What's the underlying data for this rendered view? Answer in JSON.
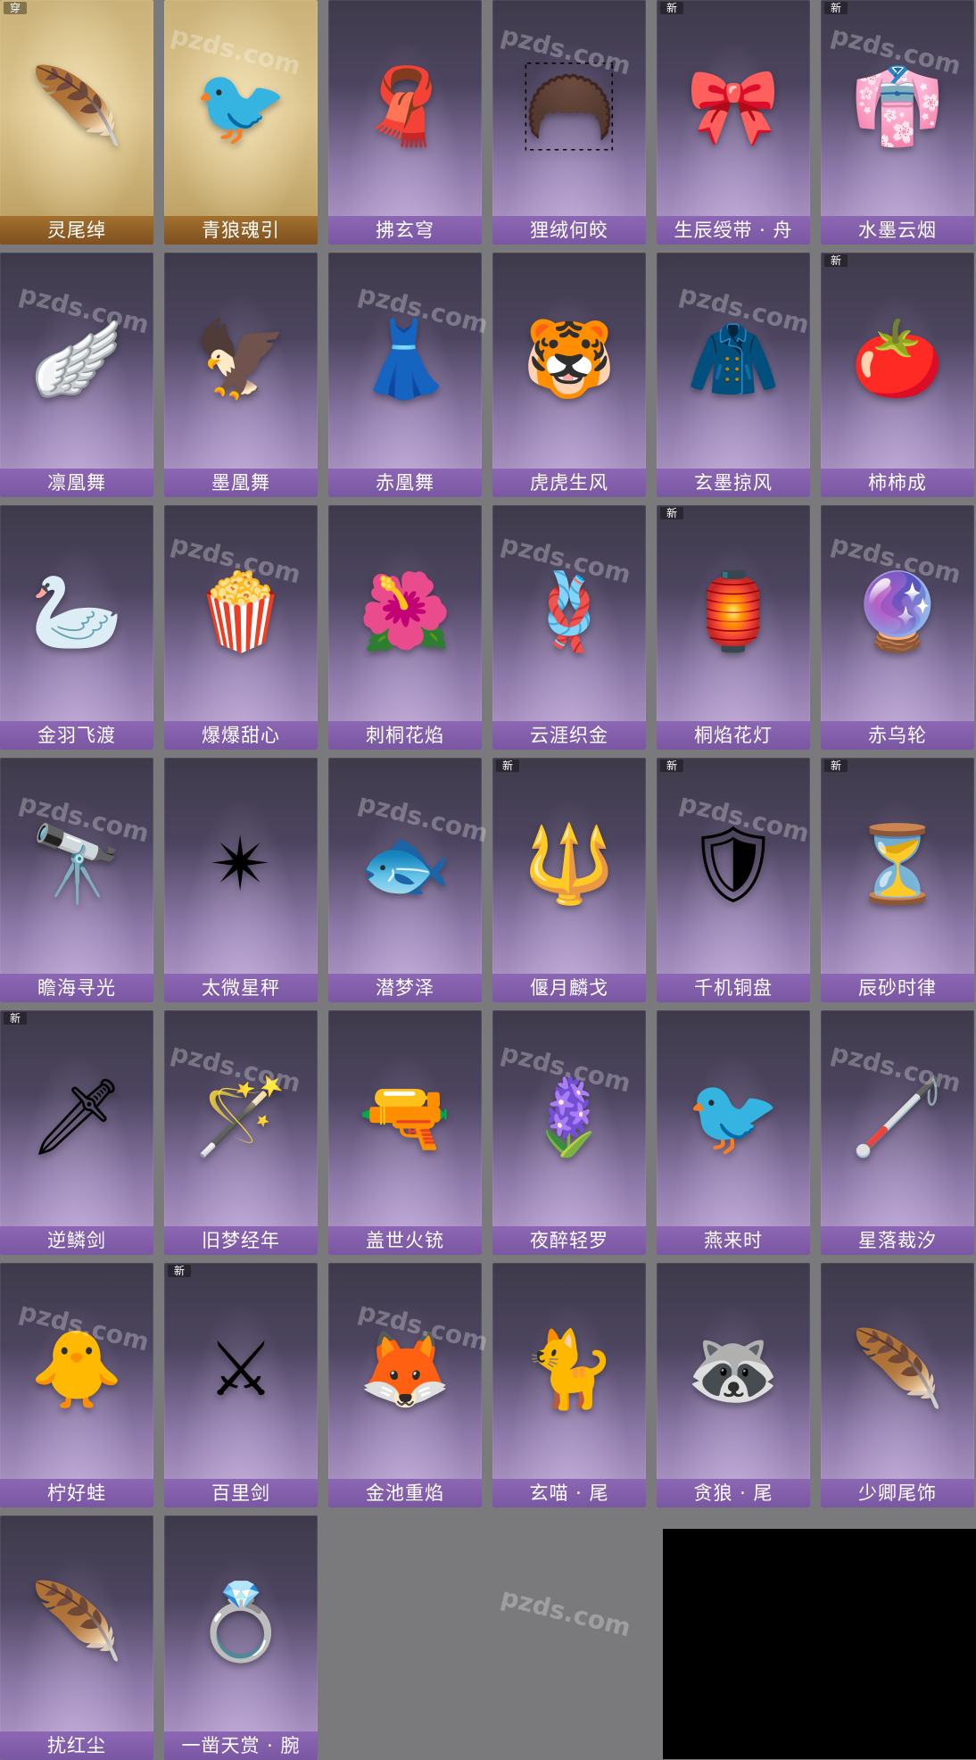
{
  "watermark": "pzds.com",
  "items": [
    {
      "label": "灵尾绰",
      "icon": "🪶",
      "badge": "穿",
      "theme": "gold"
    },
    {
      "label": "青狼魂引",
      "icon": "🐦",
      "badge": "",
      "theme": "gold"
    },
    {
      "label": "拂玄穹",
      "icon": "🧣",
      "badge": "",
      "theme": "purple"
    },
    {
      "label": "狸绒何皎",
      "icon": "🦱",
      "badge": "",
      "theme": "purple"
    },
    {
      "label": "生辰绶带 · 舟",
      "icon": "🎀",
      "badge": "新",
      "theme": "purple"
    },
    {
      "label": "水墨云烟",
      "icon": "👘",
      "badge": "新",
      "theme": "purple"
    },
    {
      "label": "凛凰舞",
      "icon": "🪽",
      "badge": "",
      "theme": "purple"
    },
    {
      "label": "墨凰舞",
      "icon": "🦅",
      "badge": "",
      "theme": "purple"
    },
    {
      "label": "赤凰舞",
      "icon": "👗",
      "badge": "",
      "theme": "purple"
    },
    {
      "label": "虎虎生风",
      "icon": "🐯",
      "badge": "",
      "theme": "purple"
    },
    {
      "label": "玄墨掠风",
      "icon": "🧥",
      "badge": "",
      "theme": "purple"
    },
    {
      "label": "柿柿成",
      "icon": "🍅",
      "badge": "新",
      "theme": "purple"
    },
    {
      "label": "金羽飞渡",
      "icon": "🦢",
      "badge": "",
      "theme": "purple"
    },
    {
      "label": "爆爆甜心",
      "icon": "🍿",
      "badge": "",
      "theme": "purple"
    },
    {
      "label": "刺桐花焰",
      "icon": "🌺",
      "badge": "",
      "theme": "purple"
    },
    {
      "label": "云涯织金",
      "icon": "🪢",
      "badge": "",
      "theme": "purple"
    },
    {
      "label": "桐焰花灯",
      "icon": "🏮",
      "badge": "新",
      "theme": "purple"
    },
    {
      "label": "赤乌轮",
      "icon": "🔮",
      "badge": "",
      "theme": "purple"
    },
    {
      "label": "瞻海寻光",
      "icon": "🔭",
      "badge": "",
      "theme": "purple"
    },
    {
      "label": "太微星秤",
      "icon": "✴",
      "badge": "",
      "theme": "purple"
    },
    {
      "label": "潜梦泽",
      "icon": "🐟",
      "badge": "",
      "theme": "purple"
    },
    {
      "label": "偃月麟戈",
      "icon": "🔱",
      "badge": "新",
      "theme": "purple"
    },
    {
      "label": "千机铜盘",
      "icon": "🛡",
      "badge": "新",
      "theme": "purple"
    },
    {
      "label": "辰砂时律",
      "icon": "⏳",
      "badge": "新",
      "theme": "purple"
    },
    {
      "label": "逆鳞剑",
      "icon": "🗡",
      "badge": "新",
      "theme": "purple"
    },
    {
      "label": "旧梦经年",
      "icon": "🪄",
      "badge": "",
      "theme": "purple"
    },
    {
      "label": "盖世火铳",
      "icon": "🔫",
      "badge": "",
      "theme": "purple"
    },
    {
      "label": "夜醉轻罗",
      "icon": "🪻",
      "badge": "",
      "theme": "purple"
    },
    {
      "label": "燕来时",
      "icon": "🐦",
      "badge": "",
      "theme": "purple"
    },
    {
      "label": "星落裁汐",
      "icon": "🦯",
      "badge": "",
      "theme": "purple"
    },
    {
      "label": "柠好蛙",
      "icon": "🐥",
      "badge": "",
      "theme": "purple"
    },
    {
      "label": "百里剑",
      "icon": "⚔",
      "badge": "新",
      "theme": "purple"
    },
    {
      "label": "金池重焰",
      "icon": "🦊",
      "badge": "",
      "theme": "purple"
    },
    {
      "label": "玄喵 · 尾",
      "icon": "🐈",
      "badge": "",
      "theme": "purple"
    },
    {
      "label": "贪狼 · 尾",
      "icon": "🦝",
      "badge": "",
      "theme": "purple"
    },
    {
      "label": "少卿尾饰",
      "icon": "🪶",
      "badge": "",
      "theme": "purple"
    },
    {
      "label": "扰红尘",
      "icon": "🪶",
      "badge": "",
      "theme": "purple"
    },
    {
      "label": "一凿天赏 · 腕",
      "icon": "💍",
      "badge": "",
      "theme": "purple"
    }
  ]
}
